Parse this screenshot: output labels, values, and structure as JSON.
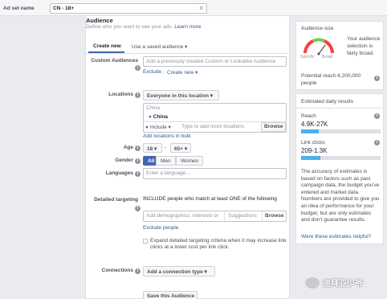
{
  "header": {
    "ad_set_name_label": "Ad set name",
    "ad_set_name_value": "CN - 18+"
  },
  "audience": {
    "title": "Audience",
    "subtitle": "Define who you want to see your ads.",
    "learn_more": "Learn more",
    "tabs": [
      "Create new",
      "Use a saved audience"
    ],
    "custom_audiences_label": "Custom Audiences",
    "custom_audiences_placeholder": "Add a previously created Custom or Lookalike Audience",
    "exclude_link": "Exclude",
    "create_new_link": "Create new",
    "locations_label": "Locations",
    "locations_dropdown": "Everyone in this location",
    "location_country": "China",
    "location_selected": "China",
    "include_dropdown": "Include",
    "location_placeholder": "Type to add more locations",
    "browse_button": "Browse",
    "add_locations_bulk": "Add locations in bulk",
    "age_label": "Age",
    "age_min": "18",
    "age_max": "65+",
    "gender_label": "Gender",
    "gender_options": [
      "All",
      "Men",
      "Women"
    ],
    "languages_label": "Languages",
    "languages_placeholder": "Enter a language...",
    "detailed_targeting_label": "Detailed targeting",
    "detailed_targeting_desc": "INCLUDE people who match at least ONE of the following",
    "detailed_targeting_placeholder": "Add demographics, interests or",
    "suggestions_label": "Suggestions",
    "browse_button_2": "Browse",
    "exclude_people_link": "Exclude people",
    "expand_text": "Expand detailed targeting criteria when it may increase link clicks at a lower cost per link click.",
    "connections_label": "Connections",
    "connections_dropdown": "Add a connection type",
    "save_audience_button": "Save this Audience"
  },
  "audience_size": {
    "title": "Audience size",
    "specific_label": "Specific",
    "broad_label": "Broad",
    "description": "Your audience selection is fairly broad.",
    "potential_reach": "Potential reach:4,200,000 people",
    "gauge_level": 0.7
  },
  "estimated_results": {
    "title": "Estimated daily results",
    "reach_label": "Reach",
    "reach_value": "4.9K-27K",
    "reach_fill": 0.22,
    "link_clicks_label": "Link clicks",
    "link_clicks_value": "209-1.3K",
    "link_clicks_fill": 0.24,
    "disclaimer": "The accuracy of estimates is based on factors such as past campaign data, the budget you've entered and market data. Numbers are provided to give you an idea of performance for your budget, but are only estimates and don't guarantee results.",
    "helpful_link": "Were these estimates helpful?"
  },
  "watermark": {
    "text": "迪拜亚少爷"
  }
}
